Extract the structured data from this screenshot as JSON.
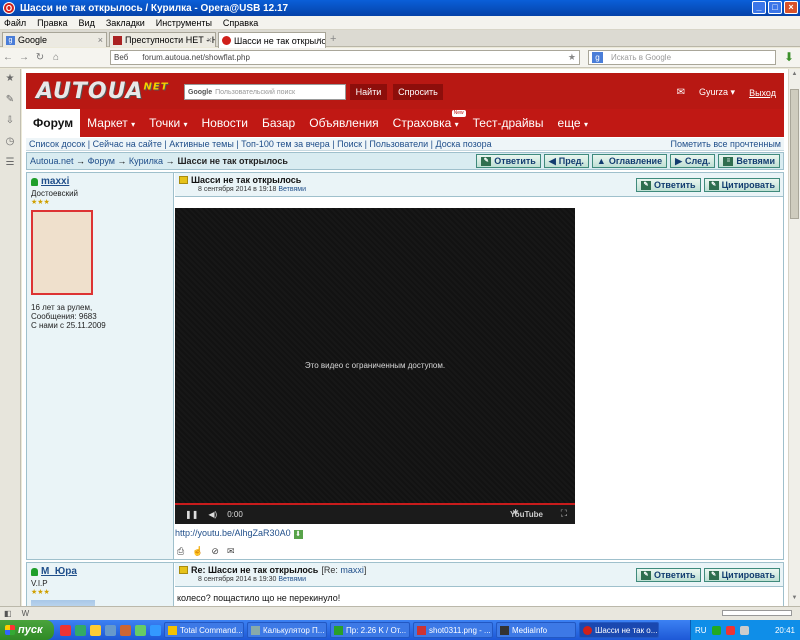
{
  "window": {
    "title": "Шасси не так открылось / Курилка - Opera@USB 12.17",
    "app_icon_letter": "O"
  },
  "menu": [
    "Файл",
    "Правка",
    "Вид",
    "Закладки",
    "Инструменты",
    "Справка"
  ],
  "tabs": [
    {
      "label": "Google",
      "active": false
    },
    {
      "label": "Преступности НЕТ - Но...",
      "active": false
    },
    {
      "label": "Шасси не так открылось...",
      "active": true
    }
  ],
  "address": {
    "web_label": "Веб",
    "url": "forum.autoua.net/showflat.php",
    "search_placeholder": "Искать в Google"
  },
  "site": {
    "logo": "AUTOUA",
    "logo_sup": "NET",
    "google_placeholder": "Пользовательский поиск",
    "google_label": "Google",
    "find_button": "Найти",
    "ask_button": "Спросить",
    "username": "Gyurza",
    "logout": "Выход"
  },
  "nav": [
    {
      "label": "Форум",
      "active": true
    },
    {
      "label": "Маркет",
      "arrow": true
    },
    {
      "label": "Точки",
      "arrow": true
    },
    {
      "label": "Новости"
    },
    {
      "label": "Базар"
    },
    {
      "label": "Объявления"
    },
    {
      "label": "Страховка",
      "arrow": true,
      "badge": "New"
    },
    {
      "label": "Тест-драйвы"
    },
    {
      "label": "еще",
      "arrow": true
    }
  ],
  "links": {
    "items": [
      "Список досок",
      "Сейчас на сайте",
      "Активные темы",
      "Топ-100 тем за вчера",
      "Поиск",
      "Пользователи",
      "Доска позора"
    ],
    "mark_read": "Пометить все прочтенным"
  },
  "breadcrumb": {
    "items": [
      "Autoua.net",
      "Форум",
      "Курилка"
    ],
    "current": "Шасси не так открылось",
    "buttons": [
      "Ответить",
      "Пред.",
      "Оглавление",
      "След.",
      "Ветвями"
    ]
  },
  "post1": {
    "user": {
      "name": "maxxi",
      "title": "Достоевский",
      "stars": "★★★",
      "stats": [
        "16 лет за рулем,",
        "Сообщения: 9683",
        "С нами с 25.11.2009"
      ]
    },
    "subject": "Шасси не так открылось",
    "date": "8 сентября 2014 в 19:18",
    "threads_link": "Ветвями",
    "buttons": [
      "Ответить",
      "Цитировать"
    ],
    "video": {
      "message": "Это видео с ограниченным доступом.",
      "time": "0:00",
      "logo": "YouTube"
    },
    "link": "http://youtu.be/AlhgZaR30A0"
  },
  "post2": {
    "user": {
      "name": "M_Юра",
      "title": "V.I.P",
      "stars": "★★★"
    },
    "subject": "Re: Шасси не так открылось",
    "re_prefix": "[Re: ",
    "re_user": "maxxi",
    "re_suffix": "]",
    "date": "8 сентября 2014 в 19:30",
    "threads_link": "Ветвями",
    "buttons": [
      "Ответить",
      "Цитировать"
    ],
    "body": "колесо? пощастило що не перекинуло!"
  },
  "taskbar": {
    "start": "пуск",
    "tasks": [
      {
        "label": "Total Command...",
        "color": "#f2c200"
      },
      {
        "label": "Калькулятор П...",
        "color": "#8aa"
      },
      {
        "label": "Пр: 2.26 K / От...",
        "color": "#2aa02a"
      },
      {
        "label": "shot0311.png - ...",
        "color": "#c33"
      },
      {
        "label": "MediaInfo",
        "color": "#333"
      },
      {
        "label": "Шасси не так о...",
        "color": "#d0201a",
        "active": true
      }
    ],
    "lang": "RU",
    "clock": "20:41"
  }
}
